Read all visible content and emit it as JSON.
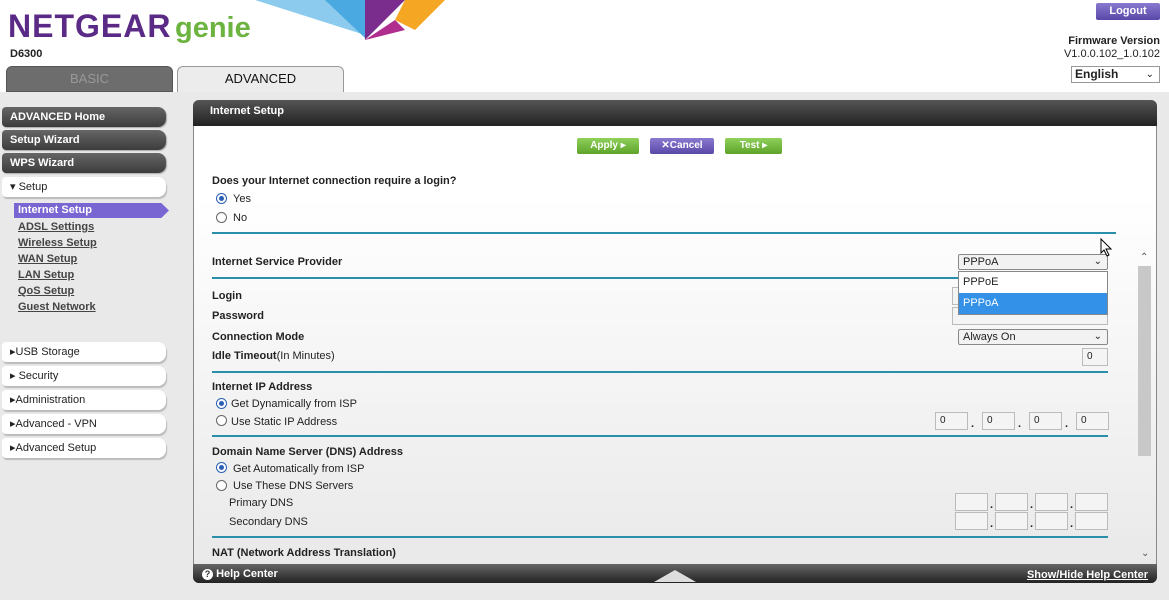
{
  "header": {
    "logo_brand": "NETGEAR",
    "logo_product": "genie",
    "model": "D6300",
    "logout": "Logout",
    "firmware_label": "Firmware Version",
    "firmware_value": "V1.0.0.102_1.0.102",
    "language": "English"
  },
  "tabs": [
    {
      "label": "BASIC",
      "active": false
    },
    {
      "label": "ADVANCED",
      "active": true
    }
  ],
  "sidebar": {
    "top_items": [
      "ADVANCED Home",
      "Setup Wizard",
      "WPS Wizard"
    ],
    "setup": "Setup",
    "setup_items": [
      "Internet Setup",
      "ADSL Settings",
      "Wireless Setup",
      "WAN Setup",
      "LAN Setup",
      "QoS Setup",
      "Guest Network"
    ],
    "selected": "Internet Setup",
    "sections": [
      "USB Storage",
      "Security",
      "Administration",
      "Advanced - VPN",
      "Advanced Setup"
    ]
  },
  "panel": {
    "title": "Internet Setup",
    "apply": "Apply ▸",
    "cancel": "Cancel",
    "test": "Test ▸",
    "login_question": "Does your Internet connection require a login?",
    "yes": "Yes",
    "no": "No",
    "login_required": "Yes",
    "isp_label": "Internet Service Provider",
    "isp_value": "PPPoA",
    "isp_options": [
      "PPPoE",
      "PPPoA"
    ],
    "login": "Login",
    "password": "Password",
    "conn_mode_label": "Connection Mode",
    "conn_mode_value": "Always On",
    "idle_label": "Idle Timeout",
    "idle_unit": "(In Minutes)",
    "idle_value": "0",
    "ip_title": "Internet IP Address",
    "ip_dynamic": "Get Dynamically from ISP",
    "ip_static": "Use Static IP Address",
    "ip_octets": [
      "0",
      "0",
      "0",
      "0"
    ],
    "dns_title": "Domain Name Server (DNS) Address",
    "dns_auto": "Get Automatically from ISP",
    "dns_manual": "Use These DNS Servers",
    "primary_dns": "Primary DNS",
    "secondary_dns": "Secondary DNS",
    "nat_title": "NAT (Network Address Translation)"
  },
  "footer": {
    "help": "Help Center",
    "toggle": "Show/Hide Help Center"
  },
  "colors": {
    "brand_purple": "#5b2a86",
    "brand_green": "#6cb33f",
    "accent_line": "#2a8fa8",
    "selected_nav": "#7a66d2"
  }
}
